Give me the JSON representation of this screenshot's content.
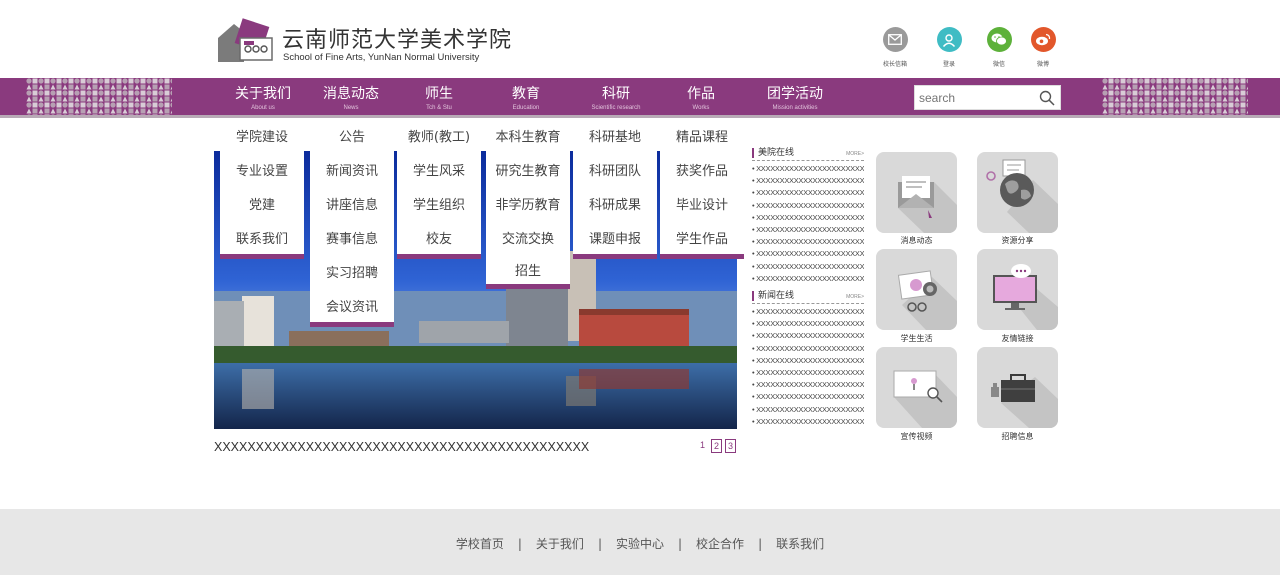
{
  "header": {
    "logo_cn": "云南师范大学美术学院",
    "logo_en": "School of Fine Arts, YunNan Normal University"
  },
  "social": [
    {
      "label": "校长信箱",
      "icon": "mail-icon",
      "color": "#9a9a9a"
    },
    {
      "label": "登录",
      "icon": "user-icon",
      "color": "#3fbcc4"
    },
    {
      "label": "微信",
      "icon": "wechat-icon",
      "color": "#5db13a"
    },
    {
      "label": "微博",
      "icon": "weibo-icon",
      "color": "#e2572b"
    }
  ],
  "nav": [
    {
      "cn": "关于我们",
      "en": "About us"
    },
    {
      "cn": "消息动态",
      "en": "News"
    },
    {
      "cn": "师生",
      "en": "Tch & Stu"
    },
    {
      "cn": "教育",
      "en": "Education"
    },
    {
      "cn": "科研",
      "en": "Scientific research"
    },
    {
      "cn": "作品",
      "en": "Works"
    },
    {
      "cn": "团学活动",
      "en": "Mission activities"
    }
  ],
  "search": {
    "placeholder": "search",
    "icon": "search-icon"
  },
  "dropdowns": [
    [
      "学院建设",
      "专业设置",
      "党建",
      "联系我们"
    ],
    [
      "公告",
      "新闻资讯",
      "讲座信息",
      "赛事信息",
      "实习招聘",
      "会议资讯"
    ],
    [
      "教师(教工)",
      "学生风采",
      "学生组织",
      "校友"
    ],
    [
      "本科生教育",
      "研究生教育",
      "非学历教育",
      "交流交换",
      "招生"
    ],
    [
      "科研基地",
      "科研团队",
      "科研成果",
      "课题申报"
    ],
    [
      "精品课程",
      "获奖作品",
      "毕业设计",
      "学生作品"
    ]
  ],
  "banner": {
    "caption": "XXXXXXXXXXXXXXXXXXXXXXXXXXXXXXXXXXXXXXXXXXXXX",
    "pages": [
      "1",
      "2",
      "3"
    ]
  },
  "news_online": {
    "title": "美院在线",
    "more": "MORE>",
    "items": [
      "• XXXXXXXXXXXXXXXXXXXXXXXXXXX",
      "• XXXXXXXXXXXXXXXXXXXXXXXXXXX",
      "• XXXXXXXXXXXXXXXXXXXXXXXXXXX",
      "• XXXXXXXXXXXXXXXXXXXXXXXXXXX",
      "• XXXXXXXXXXXXXXXXXXXXXXXXXXX",
      "• XXXXXXXXXXXXXXXXXXXXXXXXXXX",
      "• XXXXXXXXXXXXXXXXXXXXXXXXXXX",
      "• XXXXXXXXXXXXXXXXXXXXXXXXXXX",
      "• XXXXXXXXXXXXXXXXXXXXXXXXXXX",
      "• XXXXXXXXXXXXXXXXXXXXXXXXXXX"
    ]
  },
  "news_list": {
    "title": "新闻在线",
    "more": "MORE>",
    "items": [
      "• XXXXXXXXXXXXXXXXXXXXXXXXXXX",
      "• XXXXXXXXXXXXXXXXXXXXXXXXXXX",
      "• XXXXXXXXXXXXXXXXXXXXXXXXXXX",
      "• XXXXXXXXXXXXXXXXXXXXXXXXXXX",
      "• XXXXXXXXXXXXXXXXXXXXXXXXXXX",
      "• XXXXXXXXXXXXXXXXXXXXXXXXXXX",
      "• XXXXXXXXXXXXXXXXXXXXXXXXXXX",
      "• XXXXXXXXXXXXXXXXXXXXXXXXXXX",
      "• XXXXXXXXXXXXXXXXXXXXXXXXXXX",
      "• XXXXXXXXXXXXXXXXXXXXXXXXXXX"
    ]
  },
  "tiles": [
    {
      "label": "消息动态",
      "icon": "envelope-icon"
    },
    {
      "label": "资源分享",
      "icon": "globe-icon"
    },
    {
      "label": "学生生活",
      "icon": "camera-icon"
    },
    {
      "label": "友情链接",
      "icon": "monitor-icon"
    },
    {
      "label": "宣传视频",
      "icon": "video-icon"
    },
    {
      "label": "招聘信息",
      "icon": "briefcase-icon"
    }
  ],
  "footer": {
    "links": [
      "学校首页",
      "关于我们",
      "实验中心",
      "校企合作",
      "联系我们"
    ],
    "separator": "|"
  },
  "colors": {
    "accent": "#8a3a7e",
    "nav_bg": "#8a3a7e",
    "footer_bg": "#e7e7e7",
    "tile_bg": "#d9d9d9"
  }
}
